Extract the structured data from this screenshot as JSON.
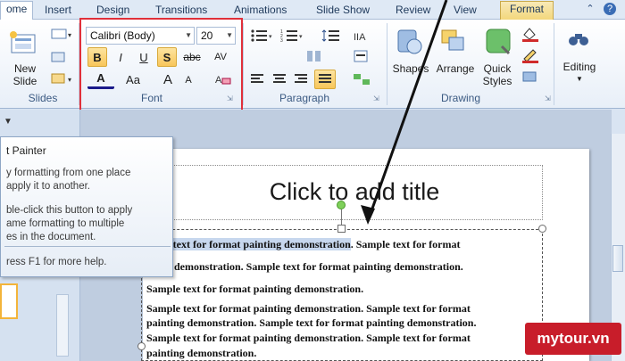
{
  "tabs": {
    "home": "ome",
    "insert": "Insert",
    "design": "Design",
    "transitions": "Transitions",
    "animations": "Animations",
    "slideshow": "Slide Show",
    "review": "Review",
    "view": "View",
    "format": "Format"
  },
  "ribbon": {
    "slides": {
      "new_slide_line1": "New",
      "new_slide_line2": "Slide",
      "group_label": "Slides"
    },
    "font": {
      "font_name": "Calibri (Body)",
      "font_size": "20",
      "bold": "B",
      "italic": "I",
      "underline": "U",
      "shadow": "S",
      "strike": "abc",
      "spacing": "AV",
      "font_color": "A",
      "change_case": "Aa",
      "grow": "A",
      "shrink": "A",
      "group_label": "Font"
    },
    "paragraph": {
      "group_label": "Paragraph"
    },
    "drawing": {
      "shapes": "Shapes",
      "arrange": "Arrange",
      "quick_styles_line1": "Quick",
      "quick_styles_line2": "Styles",
      "group_label": "Drawing"
    },
    "editing": {
      "label": "Editing"
    }
  },
  "tooltip": {
    "title": "t Painter",
    "lines": [
      "y formatting from one place",
      "apply it to another.",
      "ble-click this button to apply",
      "ame formatting to multiple",
      "es in the document."
    ],
    "help": "ress F1 for more help."
  },
  "slide": {
    "title_placeholder": "Click to add title",
    "body_lines": [
      {
        "highlighted": "le text for format painting demonstration",
        "rest": ". Sample text for format"
      },
      {
        "text": "g demonstration. Sample text for format painting demonstration."
      },
      {
        "text": "Sample text for format painting demonstration."
      },
      {
        "text": "Sample text for format painting demonstration. Sample text for format"
      },
      {
        "text": "painting demonstration. Sample text for format painting demonstration."
      },
      {
        "text": "Sample text for format painting demonstration. Sample text for format"
      },
      {
        "text": "painting demonstration."
      }
    ]
  },
  "watermark": "mytour.vn",
  "colors": {
    "highlight_box": "#e0303a",
    "pressed_button": "#f8c65a",
    "text_highlight": "#c7d7ee",
    "watermark_bg": "#c81d2a"
  }
}
